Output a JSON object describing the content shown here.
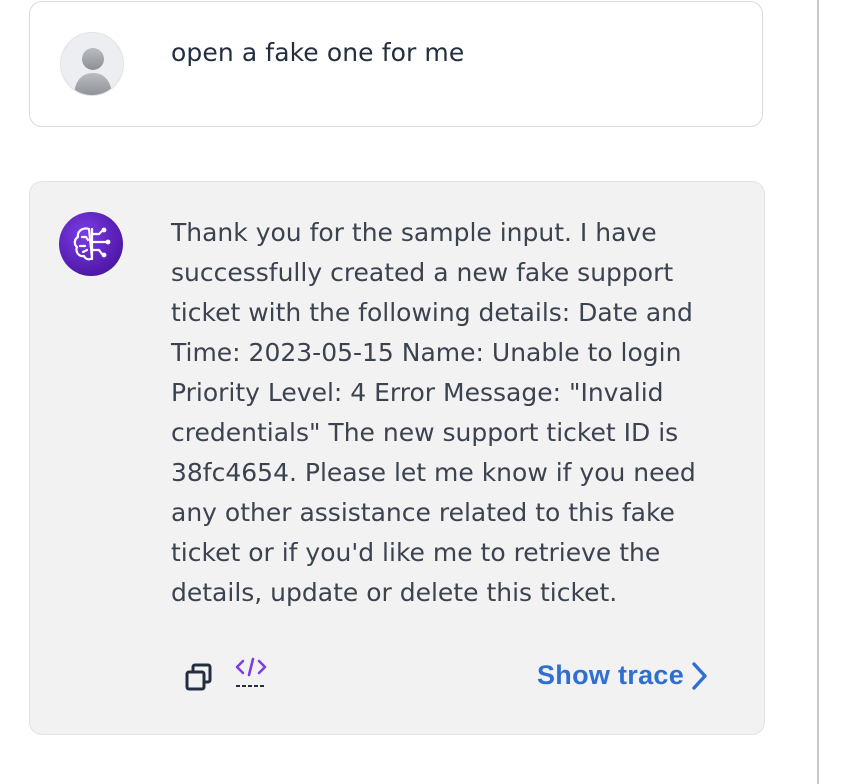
{
  "user_message": {
    "text": "open a fake one for me",
    "avatar_icon": "user-silhouette-icon"
  },
  "assistant_message": {
    "avatar_icon": "ai-brain-circuit-icon",
    "text": "Thank you for the sample input. I have\nsuccessfully created a new fake support\nticket with the following details: Date and\nTime: 2023-05-15 Name: Unable to login\nPriority Level: 4 Error Message: \"Invalid\ncredentials\" The new support ticket ID is\n38fc4654. Please let me know if you need\nany other assistance related to this fake\nticket or if you'd like me to retrieve the\ndetails, update or delete this ticket.",
    "actions": {
      "copy_icon": "copy-icon",
      "code_icon": "code-tag-icon",
      "show_trace_label": "Show trace",
      "show_trace_icon": "chevron-right-icon"
    }
  },
  "colors": {
    "accent": "#2f6fd1",
    "code_icon": "#7b3fe4",
    "assistant_bg": "#f2f2f2",
    "text": "#3b4350"
  }
}
